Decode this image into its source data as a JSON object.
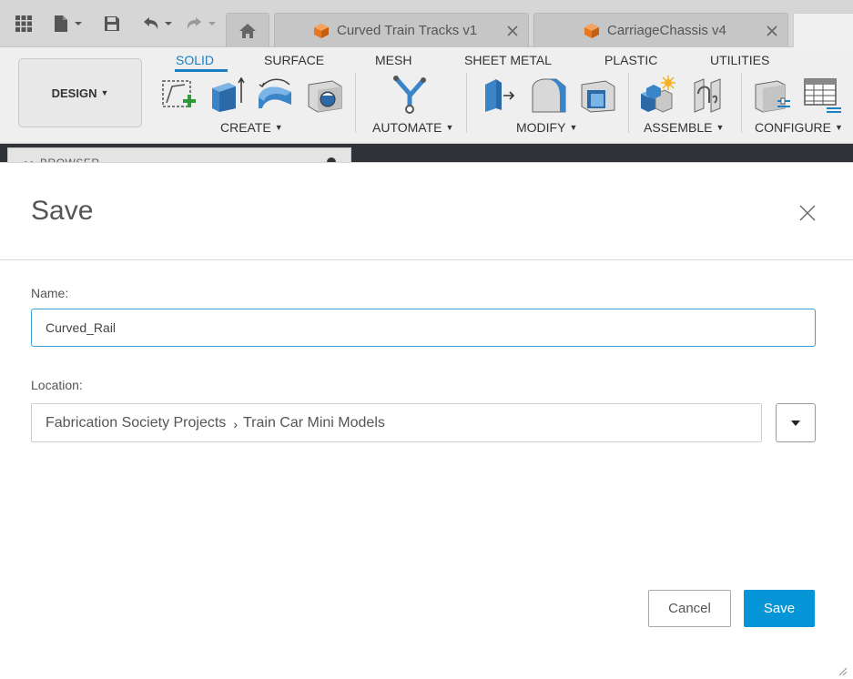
{
  "titlebar": {
    "tabs": [
      {
        "label": "Curved Train Tracks v1"
      },
      {
        "label": "CarriageChassis v4"
      }
    ]
  },
  "ribbon": {
    "design_label": "DESIGN",
    "tabs": [
      "SOLID",
      "SURFACE",
      "MESH",
      "SHEET METAL",
      "PLASTIC",
      "UTILITIES"
    ],
    "groups": {
      "create": "CREATE",
      "automate": "AUTOMATE",
      "modify": "MODIFY",
      "assemble": "ASSEMBLE",
      "configure": "CONFIGURE"
    },
    "accent_color": "#1a7fc4"
  },
  "browser_panel": {
    "label": "BROWSER"
  },
  "dialog": {
    "title": "Save",
    "name_label": "Name:",
    "name_value": "Curved_Rail",
    "location_label": "Location:",
    "location_path": [
      "Fabrication Society Projects",
      "Train Car Mini Models"
    ],
    "cancel_label": "Cancel",
    "save_label": "Save",
    "save_color": "#0696d7",
    "input_focus_color": "#3aa0d8"
  },
  "icons": {
    "grid": "grid-menu-icon",
    "file": "file-icon",
    "save": "save-disk-icon",
    "undo": "undo-icon",
    "redo": "redo-icon",
    "home": "home-icon",
    "close": "close-icon",
    "dropdown": "caret-down-icon"
  }
}
